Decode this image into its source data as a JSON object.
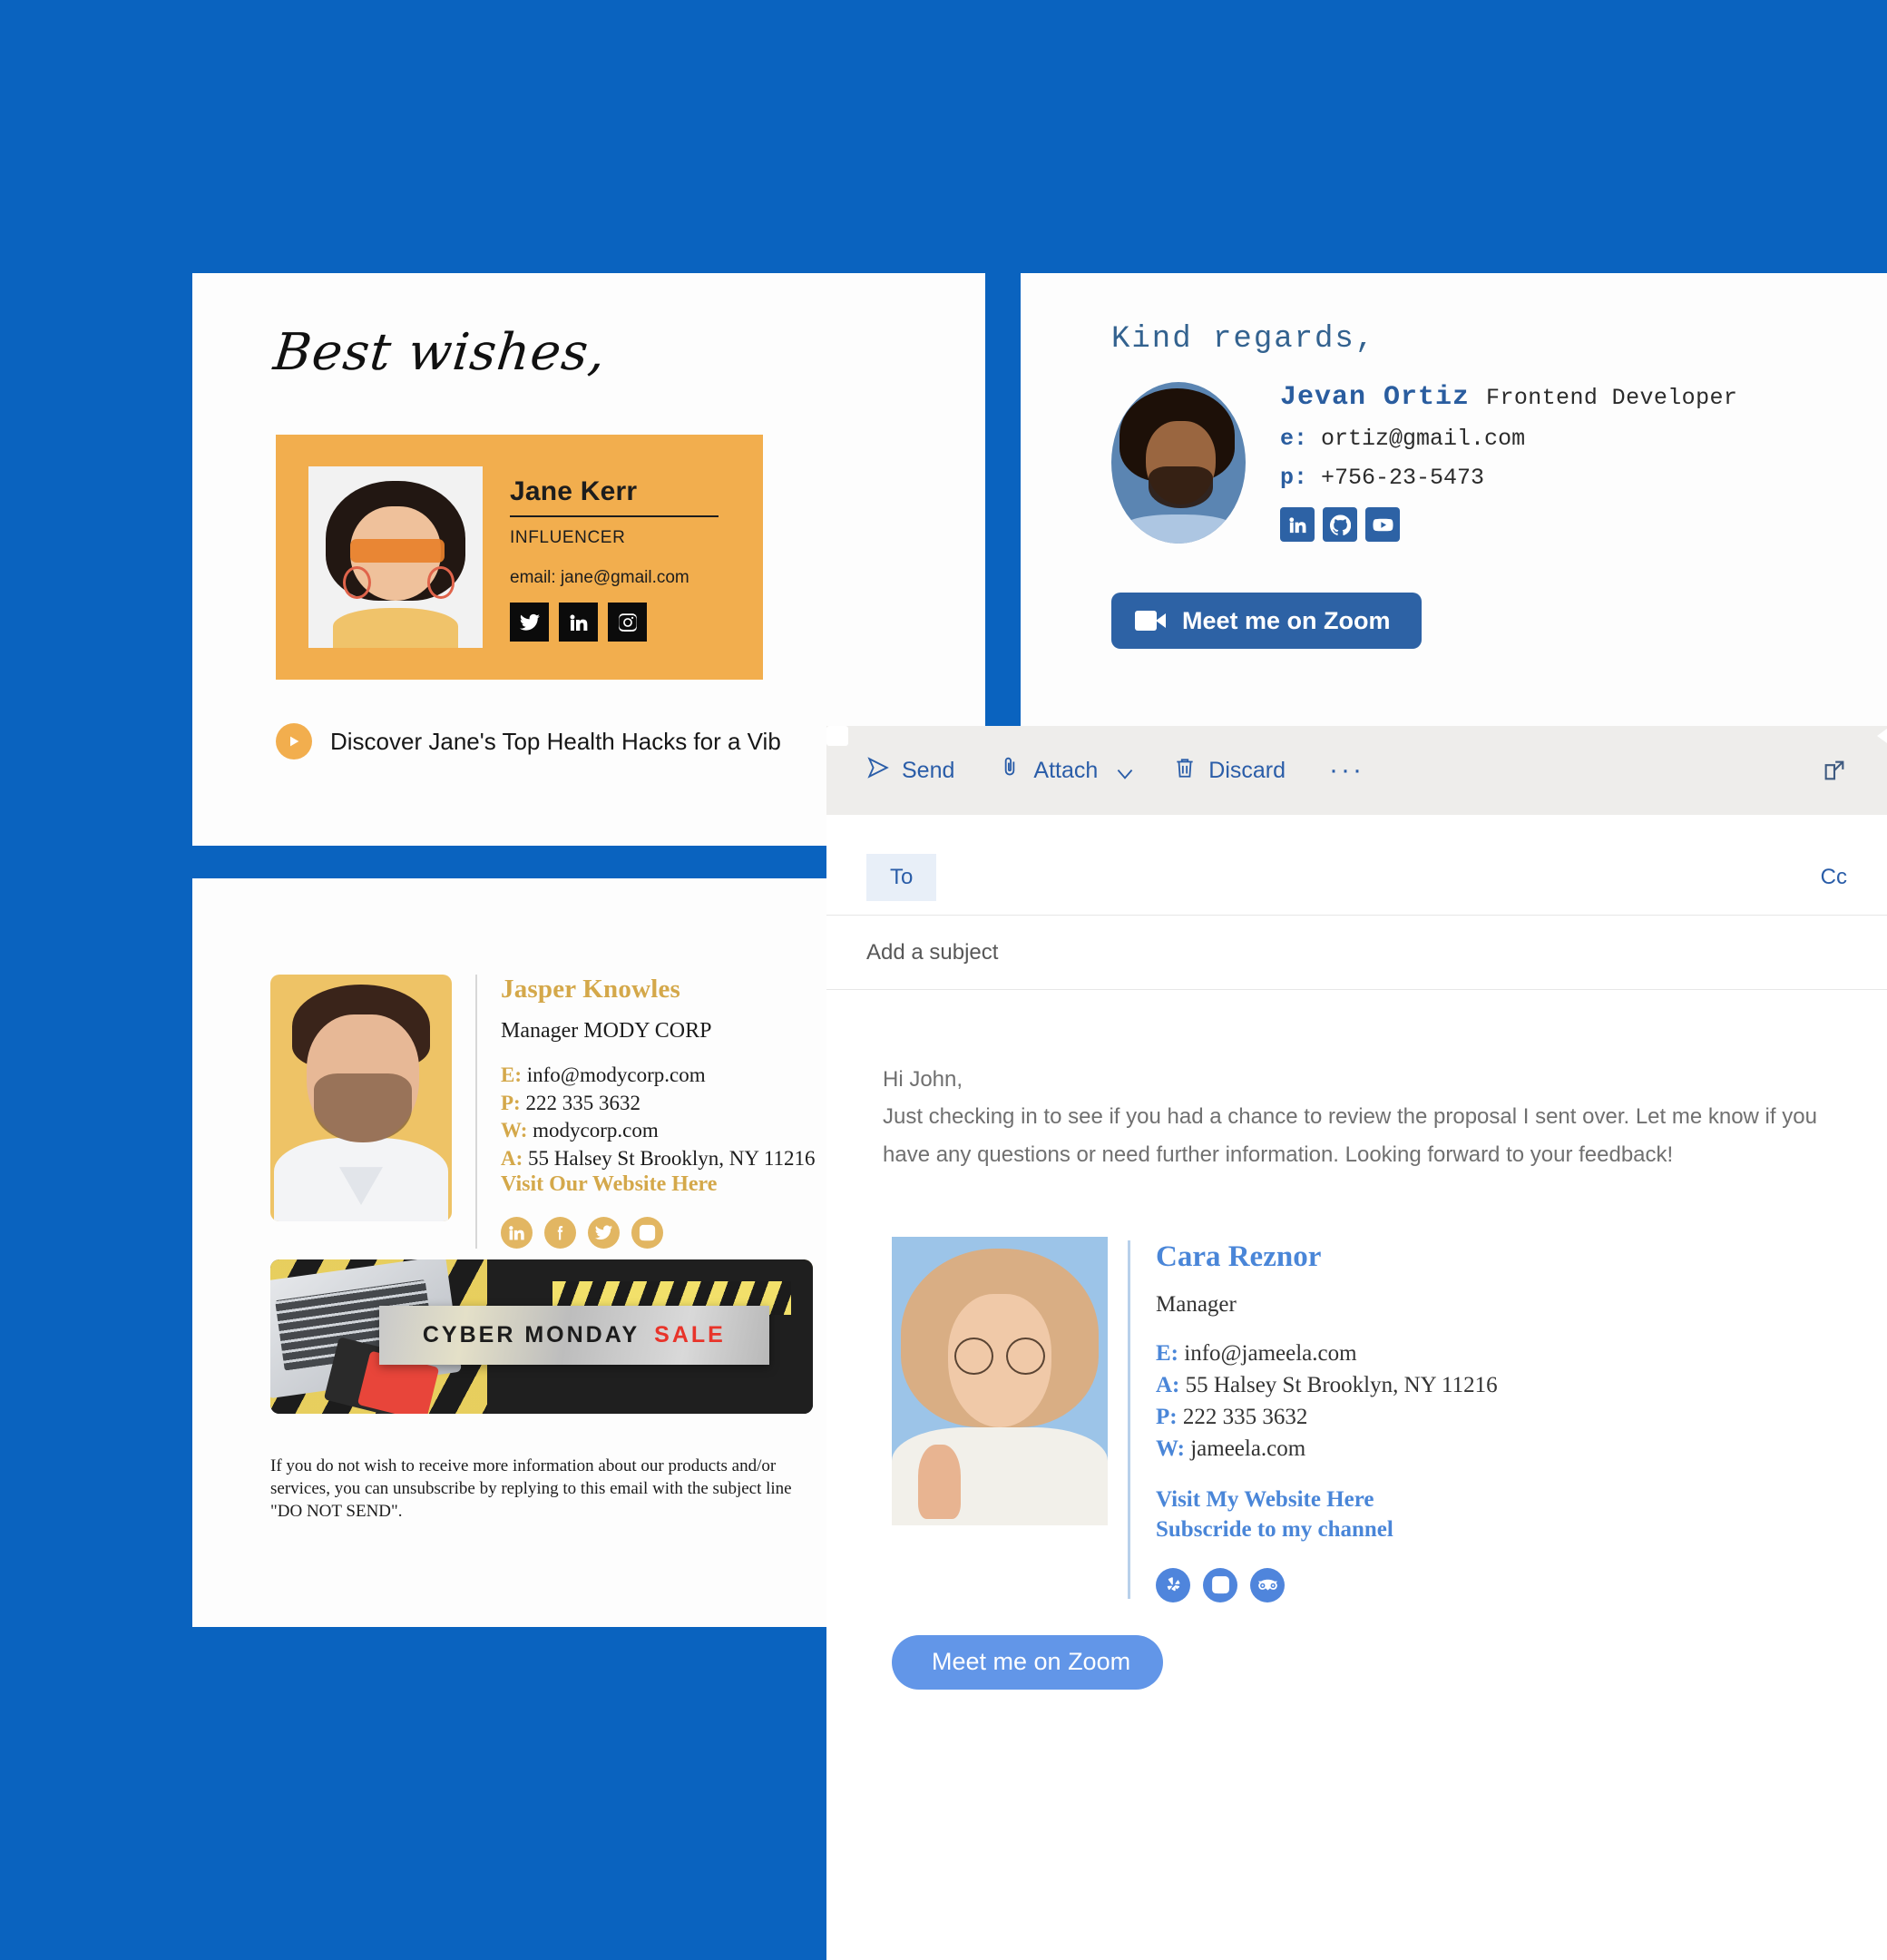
{
  "background_color": "#0a63bf",
  "card_jane": {
    "closing": "Best wishes,",
    "name": "Jane Kerr",
    "role": "INFLUENCER",
    "email": "email: jane@gmail.com",
    "band_color": "#f2ae4e",
    "socials": [
      "twitter-icon",
      "linkedin-icon",
      "instagram-icon"
    ],
    "promo_text": "Discover Jane's Top Health Hacks for a Vib"
  },
  "card_jevan": {
    "closing": "Kind regards,",
    "name": "Jevan Ortiz",
    "role": "Frontend Developer",
    "email_label": "e:",
    "email": "ortiz@gmail.com",
    "phone_label": "p:",
    "phone": "+756-23-5473",
    "accent_color": "#2d62a5",
    "socials": [
      "linkedin-icon",
      "github-icon",
      "youtube-icon"
    ],
    "zoom_button": "Meet me on Zoom"
  },
  "card_jasper": {
    "name": "Jasper Knowles",
    "role": "Manager MODY CORP",
    "accent_color": "#d4a84a",
    "contacts": [
      {
        "label": "E:",
        "value": "info@modycorp.com"
      },
      {
        "label": "P:",
        "value": "222 335 3632"
      },
      {
        "label": "W:",
        "value": "modycorp.com"
      },
      {
        "label": "A:",
        "value": "55 Halsey St Brooklyn, NY 11216"
      }
    ],
    "website_link": "Visit Our Website Here",
    "socials": [
      "linkedin-icon",
      "facebook-icon",
      "twitter-icon",
      "instagram-icon"
    ],
    "banner": {
      "text_main": "CYBER  MONDAY",
      "text_accent": "SALE"
    },
    "disclaimer": "If you do not wish to receive more information about our products and/or services, you can unsubscribe by replying to this email with the subject line \"DO NOT SEND\"."
  },
  "compose": {
    "toolbar": {
      "send": "Send",
      "attach": "Attach",
      "discard": "Discard",
      "more": "···"
    },
    "to_label": "To",
    "to_value": "",
    "to_placeholder": "",
    "cc_label": "Cc",
    "subject_value": "",
    "subject_placeholder": "Add a subject",
    "body": {
      "greeting": "Hi John,",
      "paragraph": "Just checking in to see if you had a chance to review the proposal I sent over. Let me know if you have any questions or need further information. Looking forward to your feedback!"
    },
    "signature": {
      "name": "Cara Reznor",
      "role": "Manager",
      "accent_color": "#4a86d8",
      "contacts": [
        {
          "label": "E:",
          "value": "info@jameela.com"
        },
        {
          "label": "A:",
          "value": "55 Halsey St Brooklyn, NY 11216"
        },
        {
          "label": "P:",
          "value": "222 335 3632"
        },
        {
          "label": "W:",
          "value": "jameela.com"
        }
      ],
      "link_website": "Visit My Website Here",
      "link_channel": "Subscride to my channel",
      "socials": [
        "yelp-icon",
        "instagram-icon",
        "tripadvisor-icon"
      ],
      "zoom_button": "Meet me on Zoom"
    }
  }
}
